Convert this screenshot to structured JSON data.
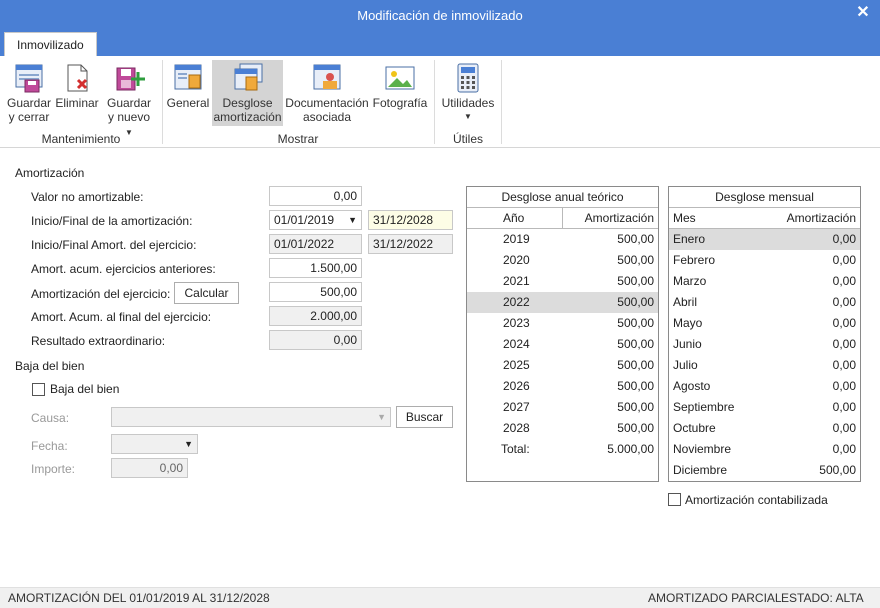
{
  "window": {
    "title": "Modificación de inmovilizado"
  },
  "tabs": [
    {
      "label": "Inmovilizado"
    }
  ],
  "ribbon": {
    "mantenimiento": {
      "label": "Mantenimiento",
      "guardar_cerrar": [
        "Guardar",
        "y cerrar"
      ],
      "eliminar": "Eliminar",
      "guardar_nuevo": [
        "Guardar",
        "y nuevo"
      ]
    },
    "mostrar": {
      "label": "Mostrar",
      "general": "General",
      "desglose": [
        "Desglose",
        "amortización"
      ],
      "documentacion": [
        "Documentación",
        "asociada"
      ],
      "fotografia": "Fotografía"
    },
    "utiles": {
      "label": "Útiles",
      "utilidades": "Utilidades"
    }
  },
  "amortizacion": {
    "section_title": "Amortización",
    "valor_no_amortizable": {
      "label": "Valor no amortizable:",
      "value": "0,00"
    },
    "inicio_final": {
      "label": "Inicio/Final de la amortización:",
      "start": "01/01/2019",
      "end": "31/12/2028"
    },
    "inicio_final_ejercicio": {
      "label": "Inicio/Final Amort. del ejercicio:",
      "start": "01/01/2022",
      "end": "31/12/2022"
    },
    "amort_acum_anteriores": {
      "label": "Amort. acum. ejercicios anteriores:",
      "value": "1.500,00"
    },
    "amortizacion_ejercicio": {
      "label": "Amortización del ejercicio:",
      "button": "Calcular",
      "value": "500,00"
    },
    "amort_acum_final": {
      "label": "Amort. Acum. al final del ejercicio:",
      "value": "2.000,00"
    },
    "resultado_extraordinario": {
      "label": "Resultado extraordinario:",
      "value": "0,00"
    }
  },
  "baja": {
    "section_title": "Baja del bien",
    "checkbox_label": "Baja del bien",
    "causa_label": "Causa:",
    "causa_value": "",
    "buscar": "Buscar",
    "fecha_label": "Fecha:",
    "fecha_value": "",
    "importe_label": "Importe:",
    "importe_value": "0,00"
  },
  "desglose_anual": {
    "title": "Desglose anual teórico",
    "col_year": "Año",
    "col_amount": "Amortización",
    "rows": [
      {
        "year": "2019",
        "amount": "500,00"
      },
      {
        "year": "2020",
        "amount": "500,00"
      },
      {
        "year": "2021",
        "amount": "500,00"
      },
      {
        "year": "2022",
        "amount": "500,00"
      },
      {
        "year": "2023",
        "amount": "500,00"
      },
      {
        "year": "2024",
        "amount": "500,00"
      },
      {
        "year": "2025",
        "amount": "500,00"
      },
      {
        "year": "2026",
        "amount": "500,00"
      },
      {
        "year": "2027",
        "amount": "500,00"
      },
      {
        "year": "2028",
        "amount": "500,00"
      }
    ],
    "total_label": "Total:",
    "total_value": "5.000,00",
    "selected_year": "2022"
  },
  "desglose_mensual": {
    "title": "Desglose mensual",
    "col_month": "Mes",
    "col_amount": "Amortización",
    "rows": [
      {
        "month": "Enero",
        "amount": "0,00"
      },
      {
        "month": "Febrero",
        "amount": "0,00"
      },
      {
        "month": "Marzo",
        "amount": "0,00"
      },
      {
        "month": "Abril",
        "amount": "0,00"
      },
      {
        "month": "Mayo",
        "amount": "0,00"
      },
      {
        "month": "Junio",
        "amount": "0,00"
      },
      {
        "month": "Julio",
        "amount": "0,00"
      },
      {
        "month": "Agosto",
        "amount": "0,00"
      },
      {
        "month": "Septiembre",
        "amount": "0,00"
      },
      {
        "month": "Octubre",
        "amount": "0,00"
      },
      {
        "month": "Noviembre",
        "amount": "0,00"
      },
      {
        "month": "Diciembre",
        "amount": "500,00"
      }
    ],
    "selected_month": "Enero",
    "checkbox_label": "Amortización contabilizada"
  },
  "status": {
    "left": "AMORTIZACIÓN DEL 01/01/2019 AL 31/12/2028",
    "middle": "AMORTIZADO PARCIAL",
    "right": "ESTADO: ALTA"
  },
  "colors": {
    "accent": "#4a7fd4",
    "selected_row": "#dcdcdc",
    "readonly_field": "#f0f0f0"
  }
}
